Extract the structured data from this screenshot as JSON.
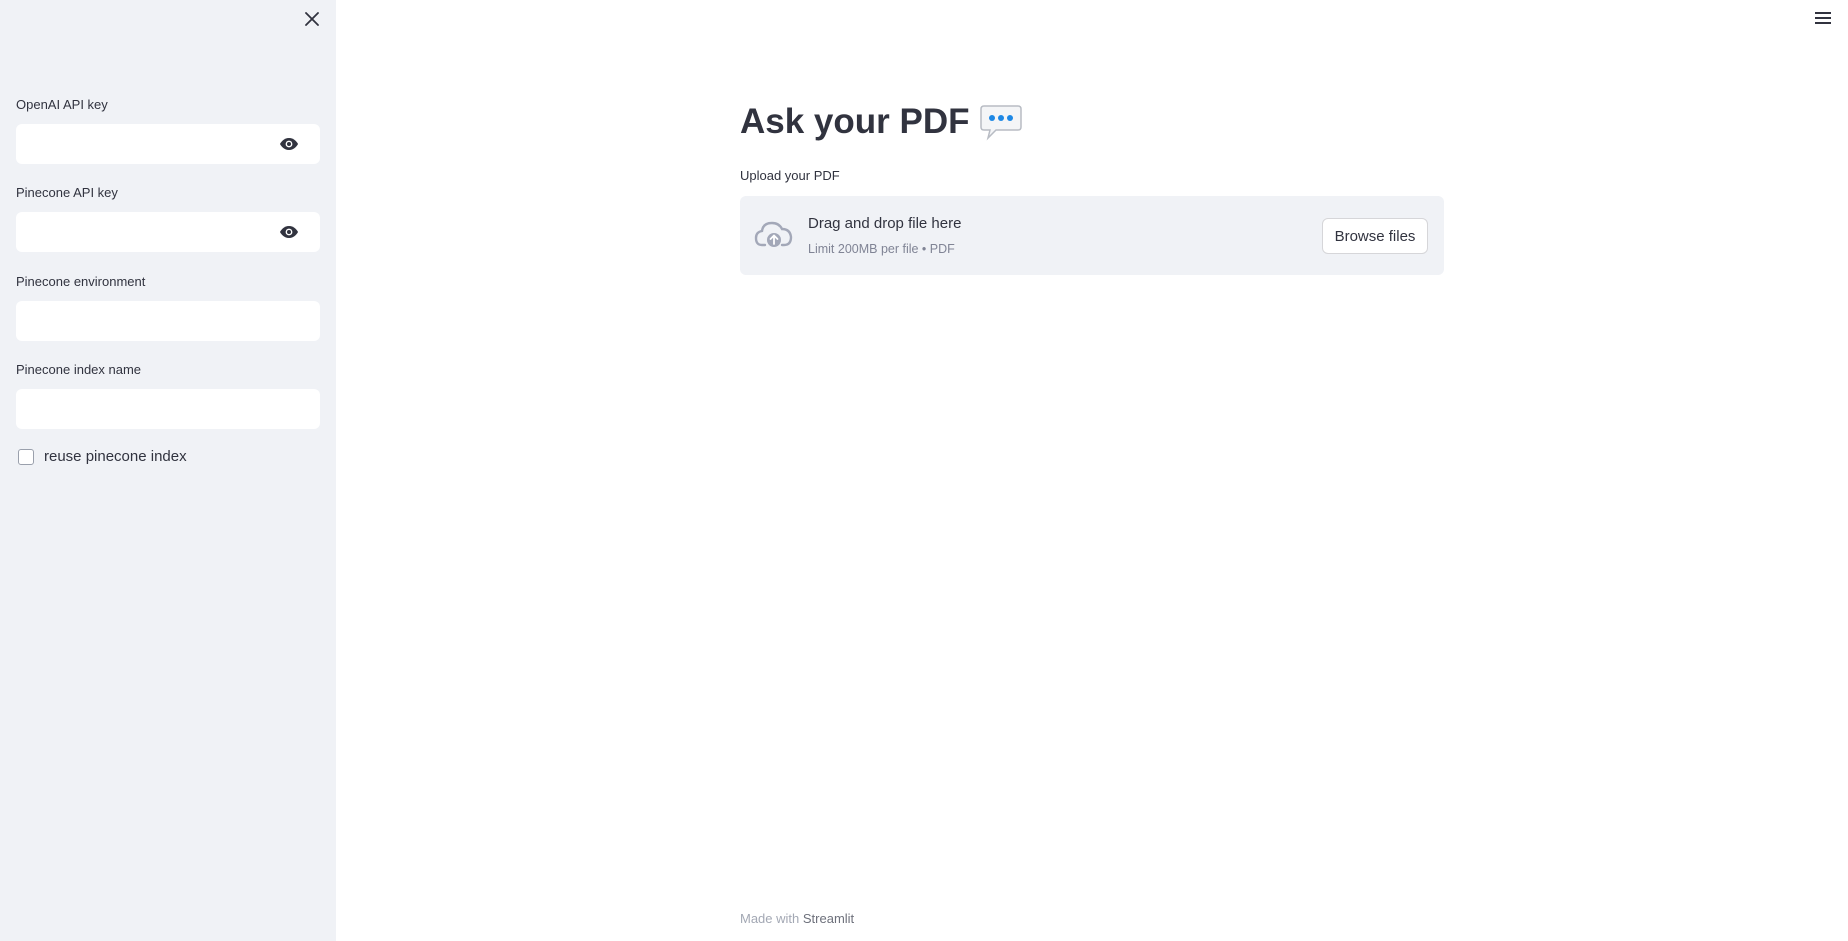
{
  "sidebar": {
    "fields": [
      {
        "label": "OpenAI API key",
        "value": "",
        "type": "password"
      },
      {
        "label": "Pinecone API key",
        "value": "",
        "type": "password"
      },
      {
        "label": "Pinecone environment",
        "value": "",
        "type": "text"
      },
      {
        "label": "Pinecone index name",
        "value": "",
        "type": "text"
      }
    ],
    "checkbox": {
      "label": "reuse pinecone index",
      "checked": false
    },
    "icons": {
      "close": "close-icon",
      "reveal": "eye-icon"
    }
  },
  "header": {
    "menu_icon": "hamburger-menu-icon"
  },
  "main": {
    "title": "Ask your PDF",
    "title_icon": "speech-bubble-icon",
    "uploader": {
      "label": "Upload your PDF",
      "drop_text": "Drag and drop file here",
      "limit_text": "Limit 200MB per file • PDF",
      "browse_label": "Browse files",
      "icon": "cloud-upload-icon"
    }
  },
  "footer": {
    "prefix": "Made with",
    "brand": "Streamlit"
  },
  "colors": {
    "sidebar_bg": "#f0f2f6",
    "text": "#31333f",
    "accent_blue": "#1e88e5",
    "muted": "#808495"
  }
}
